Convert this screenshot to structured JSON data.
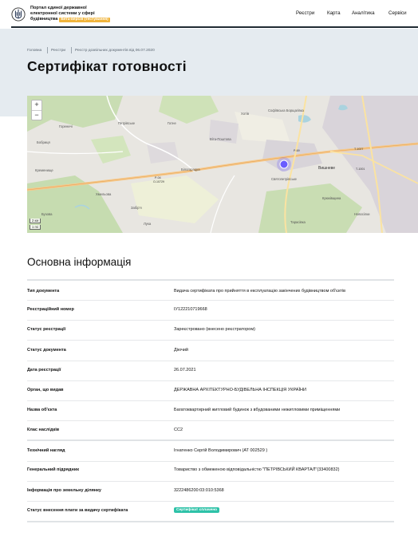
{
  "header": {
    "brand_line1": "Портал єдиної державної",
    "brand_line2": "електронної системи у сфері",
    "brand_line3": "будівництва",
    "beta_label": "Бета-версія (тестування)",
    "nav": [
      "Реєстри",
      "Карта",
      "Аналітика",
      "Сервіси"
    ]
  },
  "breadcrumb": [
    "Головна",
    "Реєстри",
    "Реєстр дозвільних документів від 06.07.2020"
  ],
  "page_title": "Сертифікат готовності",
  "map": {
    "zoom_in": "+",
    "zoom_out": "−",
    "scale_km": "2 км",
    "scale_mi": "1 mi",
    "labels": [
      "Петрівське",
      "Гатне",
      "Хотів",
      "Віта-Поштова",
      "Білогородка",
      "Святопетрівське",
      "Софіївська Борщагівка",
      "Вишневе",
      "Крюківщина",
      "Новосілки",
      "Тарасівка",
      "Гореничі",
      "Бобриця",
      "Кременище",
      "Забір'я",
      "Хмельова",
      "Лука",
      "Бузова",
      "Р-04",
      "О-10729",
      "Т-1027",
      "Т-1001",
      "Р-69"
    ],
    "accent": "#6a5cff"
  },
  "section_title": "Основна інформація",
  "rows": [
    {
      "k": "Тип документа",
      "v": "Видача сертифіката про прийняття в експлуатацію закінчених будівництвом об'єктів"
    },
    {
      "k": "Реєстраційний номер",
      "v": "ІУ122210719668"
    },
    {
      "k": "Статус реєстрації",
      "v": "Зареєстровано (внесено реєстратором)"
    },
    {
      "k": "Статус документа",
      "v": "Діючий"
    },
    {
      "k": "Дата реєстрації",
      "v": "26.07.2021"
    },
    {
      "k": "Орган, що видав",
      "v": "ДЕРЖАВНА АРХІТЕКТУРНО-БУДІВЕЛЬНА ІНСПЕКЦІЯ УКРАЇНИ"
    },
    {
      "k": "Назва об'єкта",
      "v": "Багатоквартирний житловий будинок з вбудованими нежитловими приміщеннями"
    },
    {
      "k": "Клас наслідків",
      "v": "СС2"
    },
    {
      "k": "Технічний нагляд",
      "v": "Ігнатенко Сергій Володимирович (АТ 002529 )"
    },
    {
      "k": "Генеральний підрядник",
      "v": "Товариство з обмеженою відповідальністю \"ПЕТРІВСЬКИЙ КВАРТАЛ\"(33400832)"
    },
    {
      "k": "Інформація про земельну ділянку",
      "v": "3222486200:03:010:5368"
    },
    {
      "k": "Статус внесення плати за видачу сертифіката",
      "v": "Сертифікат сплачено"
    }
  ]
}
